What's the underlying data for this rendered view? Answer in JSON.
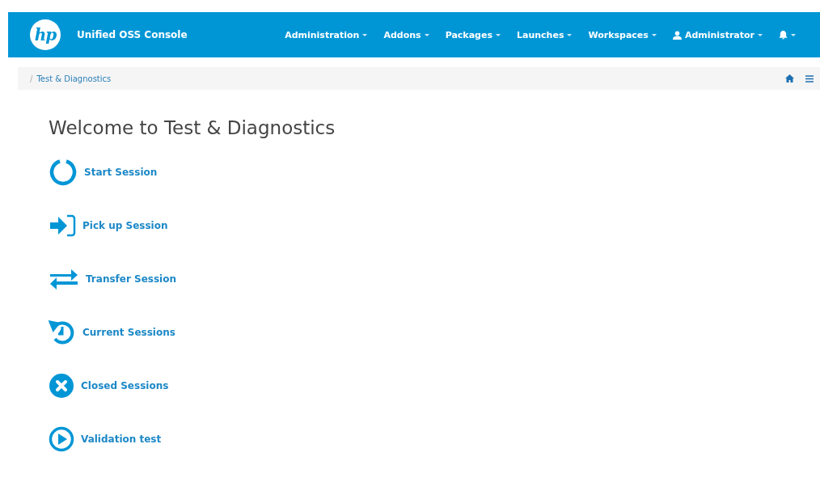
{
  "header": {
    "logo": "hp",
    "title": "Unified OSS Console",
    "nav": [
      {
        "label": "Administration",
        "kind": "text"
      },
      {
        "label": "Addons",
        "kind": "text"
      },
      {
        "label": "Packages",
        "kind": "text"
      },
      {
        "label": "Launches",
        "kind": "text"
      },
      {
        "label": "Workspaces",
        "kind": "text"
      },
      {
        "label": "Administrator",
        "kind": "user"
      },
      {
        "kind": "bell"
      }
    ]
  },
  "breadcrumb": {
    "separator": "/",
    "items": [
      "Test & Diagnostics"
    ]
  },
  "heading": "Welcome to Test & Diagnostics",
  "actions": [
    {
      "label": "Start Session",
      "kind": "start"
    },
    {
      "label": "Pick up Session",
      "kind": "pickup"
    },
    {
      "label": "Transfer Session",
      "kind": "transfer"
    },
    {
      "label": "Current Sessions",
      "kind": "current"
    },
    {
      "label": "Closed Sessions",
      "kind": "closed"
    },
    {
      "label": "Validation test",
      "kind": "validation"
    }
  ]
}
